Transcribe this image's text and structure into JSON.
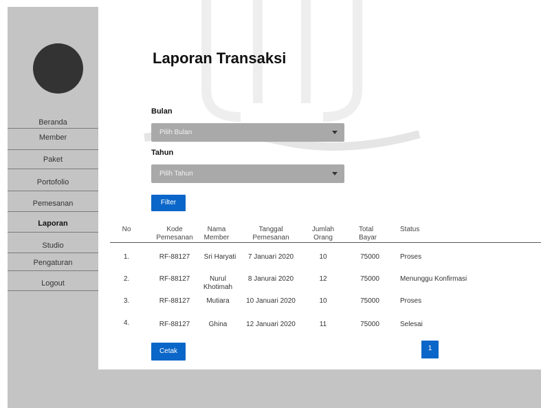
{
  "sidebar": {
    "items": [
      {
        "label": "Beranda"
      },
      {
        "label": "Member"
      },
      {
        "label": "Paket"
      },
      {
        "label": "Portofolio"
      },
      {
        "label": "Pemesanan"
      },
      {
        "label": "Laporan",
        "active": true
      },
      {
        "label": "Studio"
      },
      {
        "label": "Pengaturan"
      },
      {
        "label": "Logout"
      }
    ]
  },
  "page": {
    "title": "Laporan Transaksi"
  },
  "filters": {
    "bulan_label": "Bulan",
    "bulan_placeholder": "Pilih Bulan",
    "tahun_label": "Tahun",
    "tahun_placeholder": "Pilih Tahun",
    "filter_button": "Filter"
  },
  "table": {
    "headers": {
      "no": "No",
      "kode1": "Kode",
      "kode2": "Pemesanan",
      "nama1": "Nama",
      "nama2": "Member",
      "tanggal1": "Tanggal",
      "tanggal2": "Pemesanan",
      "jumlah1": "Jumlah",
      "jumlah2": "Orang",
      "total1": "Total",
      "total2": "Bayar",
      "status": "Status"
    },
    "rows": [
      {
        "no": "1.",
        "kode": "RF-88127",
        "nama1": "Sri Haryati",
        "nama2": "",
        "tanggal": "7 Januari 2020",
        "jumlah": "10",
        "total": "75000",
        "status": "Proses"
      },
      {
        "no": "2.",
        "kode": "RF-88127",
        "nama1": "Nurul",
        "nama2": "Khotimah",
        "tanggal": "8 Janurai 2020",
        "jumlah": "12",
        "total": "75000",
        "status": "Menunggu Konfirmasi"
      },
      {
        "no": "3.",
        "kode": "RF-88127",
        "nama1": "Mutiara",
        "nama2": "",
        "tanggal": "10 Januari 2020",
        "jumlah": "10",
        "total": "75000",
        "status": "Proses"
      },
      {
        "no": "4.",
        "kode": "RF-88127",
        "nama1": "Ghina",
        "nama2": "",
        "tanggal": "12 Januari 2020",
        "jumlah": "11",
        "total": "75000",
        "status": "Selesai"
      }
    ]
  },
  "footer": {
    "cetak_button": "Cetak",
    "page_number": "1"
  },
  "colors": {
    "sidebar_bg": "#c4c4c4",
    "accent_button": "#0a66c8",
    "select_bg": "#a9a9a9"
  },
  "icons": {
    "avatar": "avatar-circle",
    "dropdown": "caret-down-icon"
  }
}
